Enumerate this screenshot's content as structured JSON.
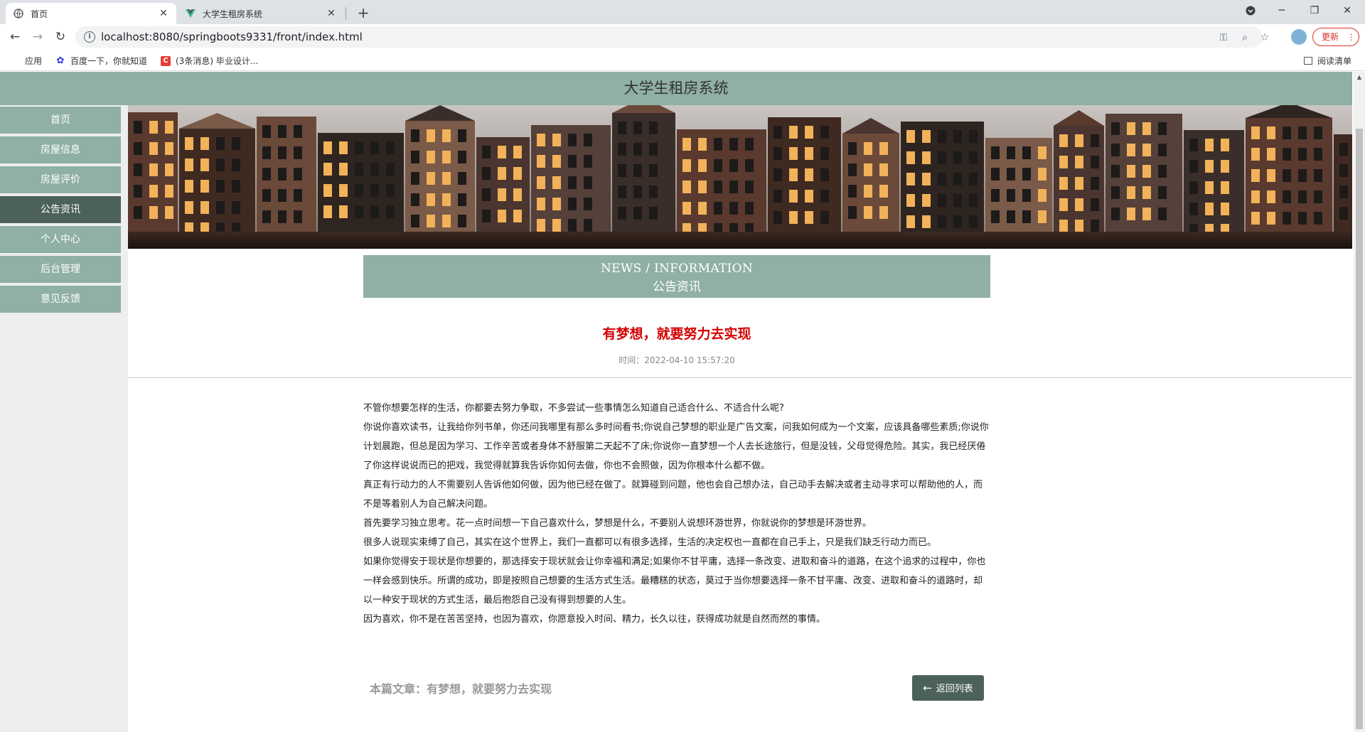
{
  "browser": {
    "tabs": [
      {
        "title": "首页",
        "icon": "globe-icon"
      },
      {
        "title": "大学生租房系统",
        "icon": "vue-logo-icon"
      }
    ],
    "url": "localhost:8080/springboots9331/front/index.html",
    "update_label": "更新",
    "bookmarks": [
      {
        "label": "应用",
        "icon": "apps-icon"
      },
      {
        "label": "百度一下，你就知道",
        "icon": "baidu-icon"
      },
      {
        "label": "(3条消息) 毕业设计...",
        "icon": "csdn-icon"
      }
    ],
    "reading_list_label": "阅读清单"
  },
  "site": {
    "title": "大学生租房系统",
    "nav": [
      {
        "label": "首页",
        "active": false
      },
      {
        "label": "房屋信息",
        "active": false
      },
      {
        "label": "房屋评价",
        "active": false
      },
      {
        "label": "公告资讯",
        "active": true
      },
      {
        "label": "个人中心",
        "active": false
      },
      {
        "label": "后台管理",
        "active": false
      },
      {
        "label": "意见反馈",
        "active": false
      }
    ],
    "colors": {
      "header": "#8fb0a3",
      "nav_active": "#4c6259",
      "title_red": "#d40000"
    }
  },
  "section": {
    "en": "NEWS / INFORMATION",
    "cn": "公告资讯"
  },
  "article": {
    "title": "有梦想，就要努力去实现",
    "time": "时间：2022-04-10 15:57:20",
    "paragraphs": [
      "不管你想要怎样的生活，你都要去努力争取，不多尝试一些事情怎么知道自己适合什么、不适合什么呢?",
      "你说你喜欢读书，让我给你列书单，你还问我哪里有那么多时间看书;你说自己梦想的职业是广告文案，问我如何成为一个文案，应该具备哪些素质;你说你计划晨跑，但总是因为学习、工作辛苦或者身体不舒服第二天起不了床;你说你一直梦想一个人去长途旅行，但是没钱，父母觉得危险。其实，我已经厌倦了你这样说说而已的把戏，我觉得就算我告诉你如何去做，你也不会照做，因为你根本什么都不做。",
      "真正有行动力的人不需要别人告诉他如何做，因为他已经在做了。就算碰到问题，他也会自己想办法，自己动手去解决或者主动寻求可以帮助他的人，而不是等着别人为自己解决问题。",
      "首先要学习独立思考。花一点时间想一下自己喜欢什么，梦想是什么，不要别人说想环游世界，你就说你的梦想是环游世界。",
      "很多人说现实束缚了自己，其实在这个世界上，我们一直都可以有很多选择，生活的决定权也一直都在自己手上，只是我们缺乏行动力而已。",
      "如果你觉得安于现状是你想要的，那选择安于现状就会让你幸福和满足;如果你不甘平庸，选择一条改变、进取和奋斗的道路，在这个追求的过程中，你也一样会感到快乐。所谓的成功，即是按照自己想要的生活方式生活。最糟糕的状态，莫过于当你想要选择一条不甘平庸、改变、进取和奋斗的道路时，却以一种安于现状的方式生活，最后抱怨自己没有得到想要的人生。",
      "因为喜欢，你不是在苦苦坚持，也因为喜欢，你愿意投入时间、精力，长久以往，获得成功就是自然而然的事情。"
    ],
    "current_label": "本篇文章：有梦想，就要努力去实现",
    "back_label": "返回列表"
  }
}
